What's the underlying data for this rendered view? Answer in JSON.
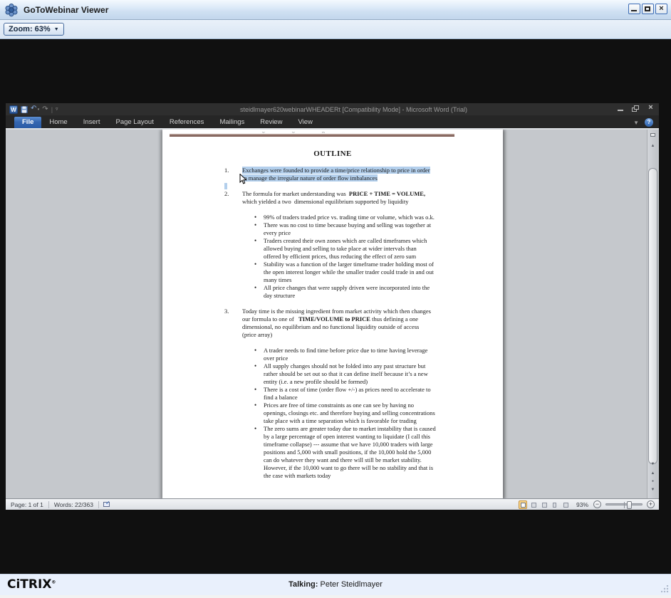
{
  "viewer": {
    "title": "GoToWebinar Viewer",
    "zoom_button_label": "Zoom: 63%"
  },
  "icons": {
    "app_icon": "gotowebinar-flower",
    "dropdown_arrow": "▼",
    "undo": "↶",
    "redo": "↷",
    "qat_overflow": "▿",
    "ribbon_collapse": "▼",
    "help": "?",
    "scroll_up": "▲",
    "scroll_down": "▼",
    "prev_page": "▲",
    "browse_object": "●",
    "next_page": "▼"
  },
  "colors": {
    "selection_highlight": "#b3cfec",
    "file_tab_blue": "#3567b1",
    "header_rule": "#ab928a",
    "active_view_button": "#fbd78b",
    "titlebar_blue": "#cfe0f2"
  },
  "word": {
    "title": "steidlmayer620webinarWHEADERt [Compatibility Mode]  -  Microsoft Word (Trial)",
    "logo_letter": "W",
    "tabs": [
      {
        "label": "File",
        "active": true
      },
      {
        "label": "Home",
        "active": false
      },
      {
        "label": "Insert",
        "active": false
      },
      {
        "label": "Page Layout",
        "active": false
      },
      {
        "label": "References",
        "active": false
      },
      {
        "label": "Mailings",
        "active": false
      },
      {
        "label": "Review",
        "active": false
      },
      {
        "label": "View",
        "active": false
      }
    ],
    "status": {
      "page": "Page: 1 of 1",
      "words": "Words: 22/363",
      "zoom_level": "93%"
    }
  },
  "document": {
    "heading": "OUTLINE",
    "items": [
      {
        "number": "1.",
        "selected": true,
        "lines": [
          [
            "Exchanges were founded to provide a time/price relationship to price in order"
          ],
          [
            "to manage the irregular nature of order flow imbalances"
          ]
        ],
        "bullets": []
      },
      {
        "number": "2.",
        "selected": false,
        "lines": [
          [
            "The formula for market understanding was  ",
            {
              "t": "PRICE + TIME = VOLUME,",
              "b": true
            }
          ],
          [
            "which yielded a two  dimensional equilibrium supported by liquidity"
          ]
        ],
        "bullets": [
          [
            "99% of traders traded price vs. trading time or volume, which was o.k."
          ],
          [
            "There was no cost to time because buying and selling was together at",
            "every price"
          ],
          [
            "Traders created their own zones which are called timeframes which",
            "allowed buying and selling to take place at wider intervals than",
            "offered by efficient prices, thus reducing the effect of zero sum"
          ],
          [
            "Stability was a function of the larger timeframe trader holding most of",
            "the open interest longer while the smaller trader could trade in and out",
            "many times"
          ],
          [
            "All price changes that were supply driven were incorporated into the",
            "day structure"
          ]
        ]
      },
      {
        "number": "3.",
        "selected": false,
        "lines": [
          [
            "Today time is the missing ingredient from market activity which then changes"
          ],
          [
            "our formula to one of   ",
            {
              "t": "TIME/VOLUME to PRICE",
              "b": true
            },
            " thus defining a one"
          ],
          [
            "dimensional, no equilibrium and no functional liquidity outside of access"
          ],
          [
            "(price array)"
          ]
        ],
        "bullets": [
          [
            "A trader needs to find time before price due to time having leverage",
            "over price"
          ],
          [
            "All supply changes should not be folded into any past structure but",
            "rather should be set out so that it can define itself because it’s a new",
            "entity (i.e. a new profile should be formed)"
          ],
          [
            "There is a cost of time (order flow +/-) as prices need to accelerate to",
            "find a balance"
          ],
          [
            "Prices are free of time constraints as one can see by having no",
            "openings, closings etc. and therefore buying and selling concentrations",
            "take place with a time separation which is favorable for trading"
          ],
          [
            "The zero sums are greater today due to market instability that is caused",
            "by a large percentage of open interest wanting to liquidate (I call this",
            "timeframe collapse) --- assume that we have 10,000 traders with large",
            "positions and 5,000 with small positions, if the 10,000 hold the 5,000",
            "can do whatever they want and there will still be market stability.",
            "However, if the 10,000 want to go there will be no stability and that is",
            "the case with markets today"
          ]
        ]
      }
    ]
  },
  "footer": {
    "brand": "CiTRIX",
    "registered": "®",
    "talking_label": "Talking:",
    "speaker": " Peter Steidlmayer"
  }
}
